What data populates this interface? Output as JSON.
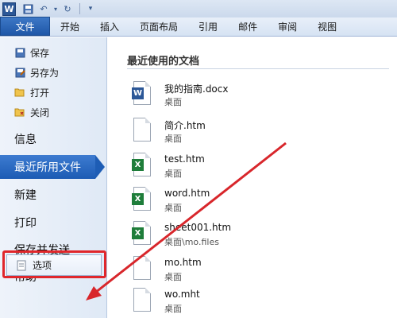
{
  "titlebar": {
    "app_icon": "W"
  },
  "tabs": {
    "file": "文件",
    "items": [
      "开始",
      "插入",
      "页面布局",
      "引用",
      "邮件",
      "审阅",
      "视图"
    ]
  },
  "backstage": {
    "commands": [
      {
        "label": "保存",
        "icon": "save-icon"
      },
      {
        "label": "另存为",
        "icon": "save-as-icon"
      },
      {
        "label": "打开",
        "icon": "open-folder-icon"
      },
      {
        "label": "关闭",
        "icon": "close-folder-icon"
      }
    ],
    "items": [
      "信息",
      "最近所用文件",
      "新建",
      "打印",
      "保存并发送",
      "帮助"
    ],
    "active_index": 1,
    "options_label": "选项"
  },
  "recent": {
    "title": "最近使用的文档",
    "documents": [
      {
        "name": "我的指南.docx",
        "path": "桌面",
        "type": "word"
      },
      {
        "name": "简介.htm",
        "path": "桌面",
        "type": "html"
      },
      {
        "name": "test.htm",
        "path": "桌面",
        "type": "excel"
      },
      {
        "name": "word.htm",
        "path": "桌面",
        "type": "excel"
      },
      {
        "name": "sheet001.htm",
        "path": "桌面\\mo.files",
        "type": "excel"
      },
      {
        "name": "mo.htm",
        "path": "桌面",
        "type": "html"
      },
      {
        "name": "wo.mht",
        "path": "桌面",
        "type": "html"
      }
    ]
  },
  "colors": {
    "accent": "#1f5bb4",
    "annotation": "#e0262b"
  }
}
